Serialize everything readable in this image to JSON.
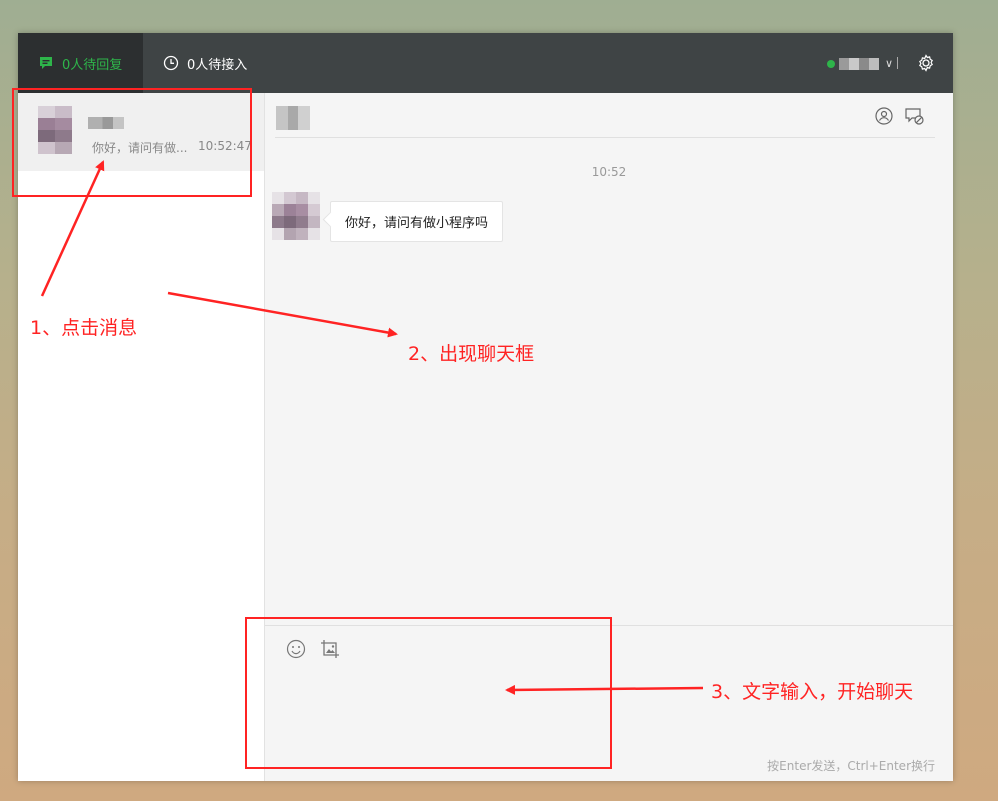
{
  "tabs": [
    {
      "label": "0人待回复",
      "icon": "chat-icon",
      "active": true
    },
    {
      "label": "0人待接入",
      "icon": "clock-icon",
      "active": false
    }
  ],
  "account": {
    "status_color": "#2eb54a",
    "dropdown_icon": "chevron-down-icon",
    "settings_icon": "gear-icon"
  },
  "conversation": {
    "preview": "你好，请问有做...",
    "time": "10:52:47"
  },
  "chat": {
    "timestamp": "10:52",
    "message": "你好，请问有做小程序吗",
    "header_icons": [
      "transfer-user-icon",
      "end-chat-icon"
    ]
  },
  "composer": {
    "tools": [
      "emoji-icon",
      "screenshot-icon"
    ],
    "hint": "按Enter发送，Ctrl+Enter换行"
  },
  "annotations": {
    "step1": "1、点击消息",
    "step2": "2、出现聊天框",
    "step3": "3、文字输入，开始聊天",
    "color": "#ff2323"
  },
  "colors": {
    "accent": "#2eb54a",
    "topbar": "#3f4445",
    "active_tab": "#2c2f30"
  }
}
